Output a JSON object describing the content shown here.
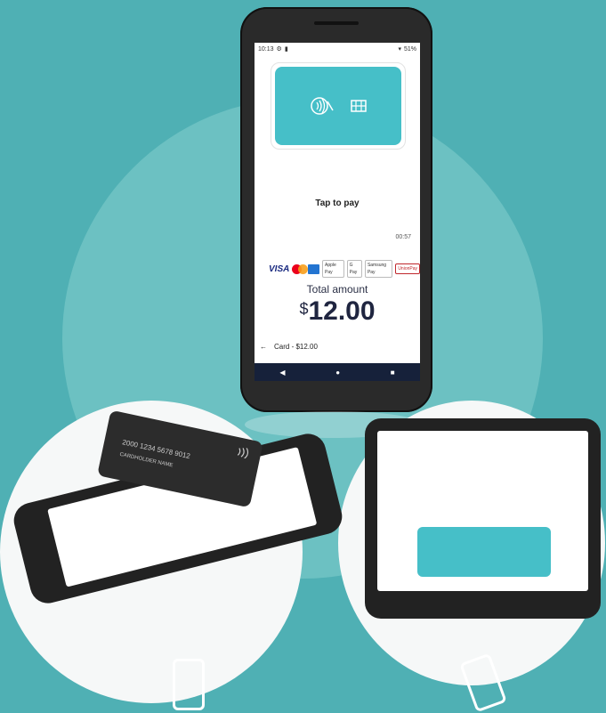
{
  "status_bar": {
    "time": "10:13",
    "battery": "51%"
  },
  "payment_screen": {
    "prompt": "Tap to pay",
    "timer": "00:57",
    "total_label": "Total amount",
    "currency": "$",
    "amount": "12.00",
    "footer_back": "←",
    "footer_text": "Card - $12.00"
  },
  "brands": [
    "VISA",
    "Mastercard",
    "AMEX",
    "Apple Pay",
    "G Pay",
    "Samsung Pay",
    "UnionPay"
  ],
  "nav": {
    "back": "◀",
    "home": "●",
    "recent": "■"
  },
  "credit_card": {
    "number": "2000 1234 5678 9012",
    "name": "CARDHOLDER NAME"
  },
  "colors": {
    "background": "#4fb0b4",
    "card": "#46bfc8",
    "navbar": "#16213a"
  }
}
